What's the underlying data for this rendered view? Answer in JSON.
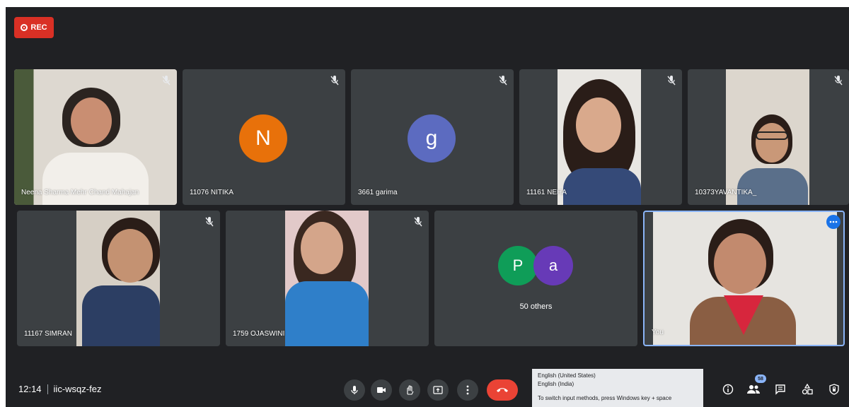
{
  "recording": {
    "label": "REC",
    "color": "#d93025"
  },
  "participants": [
    {
      "name": "Neena Sharma Mehr Chand Mahajan",
      "muted": true,
      "video": true
    },
    {
      "name": "11076 NITIKA",
      "muted": true,
      "video": false,
      "initial": "N",
      "avatar_color": "#e8710a"
    },
    {
      "name": "3661 garima",
      "muted": true,
      "video": false,
      "initial": "g",
      "avatar_color": "#5c6bc0"
    },
    {
      "name": "11161 NEHA",
      "muted": true,
      "video": true
    },
    {
      "name": "10373YAVANTIKA_",
      "muted": true,
      "video": true
    },
    {
      "name": "11167 SIMRAN",
      "muted": true,
      "video": true
    },
    {
      "name": "1759 OJASWINI",
      "muted": true,
      "video": true
    },
    {
      "name": "You",
      "muted": false,
      "video": true,
      "highlight_color": "#8ab4f8"
    }
  ],
  "others_tile": {
    "avatars": [
      {
        "initial": "P",
        "color": "#0f9d58"
      },
      {
        "initial": "a",
        "color": "#673ab7"
      }
    ],
    "label": "50 others"
  },
  "meeting": {
    "time": "12:14",
    "code": "iic-wsqz-fez"
  },
  "controls": [
    {
      "name": "microphone",
      "icon": "mic-icon"
    },
    {
      "name": "camera",
      "icon": "camera-icon"
    },
    {
      "name": "raise-hand",
      "icon": "hand-icon"
    },
    {
      "name": "present",
      "icon": "present-icon"
    },
    {
      "name": "more-options",
      "icon": "more-vert-icon"
    },
    {
      "name": "leave-call",
      "icon": "hangup-icon",
      "color": "#ea4335"
    }
  ],
  "right_controls": [
    {
      "name": "meeting-details",
      "icon": "info-icon"
    },
    {
      "name": "people",
      "icon": "people-icon",
      "badge": "58"
    },
    {
      "name": "chat",
      "icon": "chat-icon"
    },
    {
      "name": "activities",
      "icon": "activities-icon"
    },
    {
      "name": "host-controls",
      "icon": "shield-lock-icon"
    }
  ],
  "ime_popup": {
    "line1": "English (United States)",
    "line2": "English (India)",
    "line3": "To switch input methods, press Windows key + space"
  }
}
